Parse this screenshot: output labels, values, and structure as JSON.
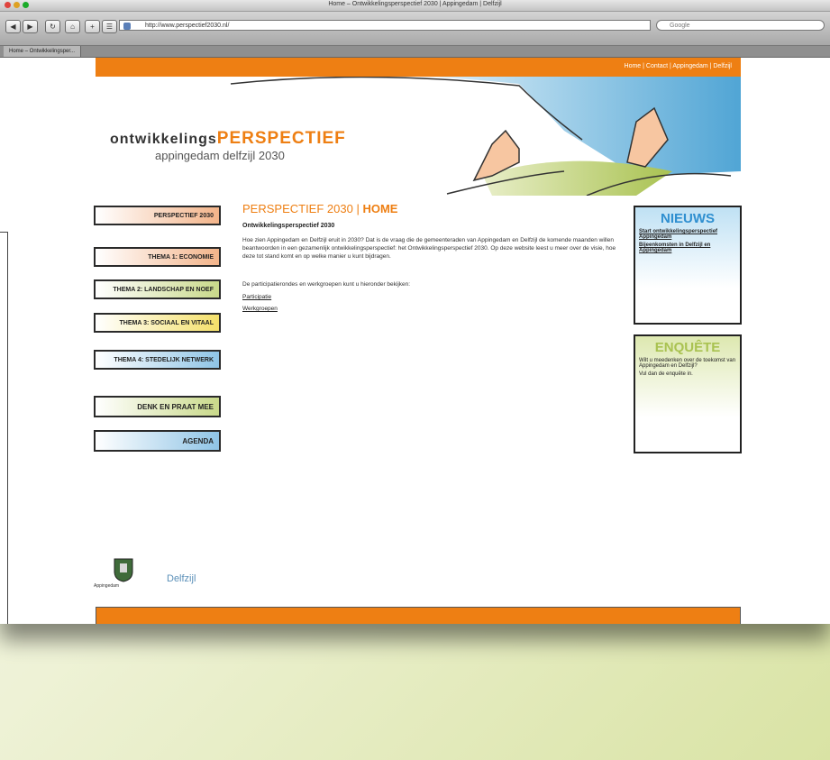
{
  "browser": {
    "window_title": "Home – Ontwikkelingsperspectief 2030 | Appingedam | Delfzijl",
    "url": "http://www.perspectief2030.nl/",
    "search_placeholder": "Google",
    "tab_label": "Home – Ontwikkelingsper..."
  },
  "site": {
    "top_links": "Home | Contact | Appingedam | Delfzijl",
    "logo_word1": "ontwikkelings",
    "logo_word2": "PERSPECTIEF",
    "logo_sub": "appingedam delfzijl 2030",
    "accent_color": "#ee7f13"
  },
  "nav": [
    {
      "label": "PERSPECTIEF 2030",
      "color": "#f3b48a"
    },
    {
      "label": "THEMA 1: ECONOMIE",
      "color": "#f3b48a"
    },
    {
      "label": "THEMA 2: LANDSCHAP EN NOEF",
      "color": "#c9d98a"
    },
    {
      "label": "THEMA 3: SOCIAAL EN VITAAL",
      "color": "#f4e06a"
    },
    {
      "label": "THEMA 4: STEDELIJK NETWERK",
      "color": "#8fc4e6"
    },
    {
      "label": "DENK EN PRAAT MEE",
      "color": "#c9d98a"
    },
    {
      "label": "AGENDA",
      "color": "#8fc4e6"
    }
  ],
  "content": {
    "title_prefix": "PERSPECTIEF 2030 | ",
    "title_main": "HOME",
    "subtitle": "Ontwikkelingsperspectief 2030",
    "paragraph1": "Hoe zien Appingedam en Delfzijl eruit in 2030? Dat is de vraag die de gemeenteraden van Appingedam en Delfzijl de komende maanden willen beantwoorden in een gezamenlijk ontwikkelingsperspectief: het Ontwikkelingsperspectief 2030. Op deze website leest u meer over de visie, hoe deze tot stand komt en op welke manier u kunt bijdragen.",
    "paragraph2": "De participatierondes en werkgroepen kunt u hieronder bekijken:",
    "link1": "Participatie",
    "link2": "Werkgroepen"
  },
  "sidebar": {
    "news_title": "NIEUWS",
    "news_items": [
      "Start ontwikkelingsperspectief Appingedam",
      "Bijeenkomsten in Delfzijl en Appingedam"
    ],
    "survey_title": "ENQUÊTE",
    "survey_text": "Wilt u meedenken over de toekomst van Appingedam en Delfzijl?",
    "survey_cta": "Vul dan de enquête in."
  },
  "footer": {
    "logo_appingedam": "Appingedam",
    "logo_delfzijl": "Delfzijl"
  }
}
